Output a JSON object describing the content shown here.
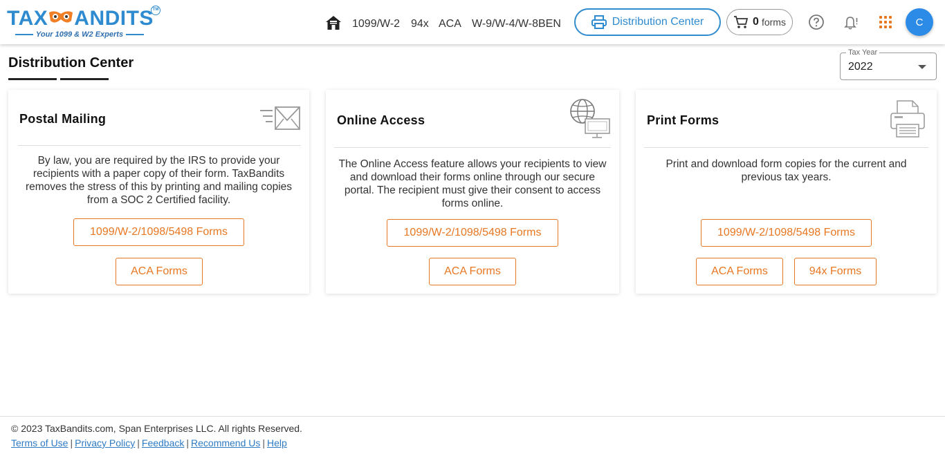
{
  "logo": {
    "name_left": "TAX",
    "name_right": "ANDITS",
    "tagline": "Your 1099 & W2 Experts",
    "tm": "TM"
  },
  "nav": {
    "links": [
      "1099/W-2",
      "94x",
      "ACA",
      "W-9/W-4/W-8BEN"
    ],
    "distribution_center": "Distribution Center",
    "cart_count": "0",
    "cart_label": "forms"
  },
  "user": {
    "avatar_initial": "C"
  },
  "page": {
    "title": "Distribution Center"
  },
  "tax_year": {
    "legend": "Tax Year",
    "value": "2022"
  },
  "cards": [
    {
      "title": "Postal Mailing",
      "description": "By law, you are required by the IRS to provide your recipients with a paper copy of their form. TaxBandits removes the stress of this by printing and mailing copies from a SOC 2 Certified facility.",
      "buttons": [
        "1099/W-2/1098/5498 Forms",
        "ACA Forms"
      ]
    },
    {
      "title": "Online Access",
      "description": "The Online Access feature allows your recipients to view and download their forms online through our secure portal. The recipient must give their consent to access forms online.",
      "buttons": [
        "1099/W-2/1098/5498 Forms",
        "ACA Forms"
      ]
    },
    {
      "title": "Print Forms",
      "description": "Print and download form copies for the current and previous tax years.",
      "buttons": [
        "1099/W-2/1098/5498 Forms",
        "ACA Forms",
        "94x Forms"
      ]
    }
  ],
  "footer": {
    "copyright": "© 2023 TaxBandits.com, Span Enterprises LLC. All rights Reserved.",
    "links": [
      "Terms of Use",
      "Privacy Policy",
      "Feedback",
      "Recommend Us",
      "Help"
    ]
  },
  "colors": {
    "brand_blue": "#2e8bd0",
    "accent_orange": "#e87722",
    "avatar_blue": "#2b8be6"
  }
}
